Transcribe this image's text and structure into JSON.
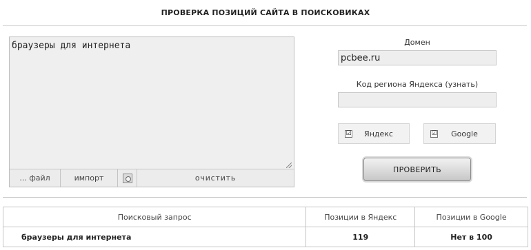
{
  "title": "ПРОВЕРКА ПОЗИЦИЙ САЙТА В ПОИСКОВИКАХ",
  "query_text": "браузеры для интернета",
  "toolbar": {
    "file_label": "... файл",
    "import_label": "импорт",
    "icon": "settings-file-icon",
    "clear_label": "очистить"
  },
  "domain": {
    "label": "Домен",
    "value": "pcbee.ru"
  },
  "region": {
    "label": "Код региона Яндекса (узнать)",
    "value": ""
  },
  "engines": {
    "yandex": {
      "label": "Яндекс",
      "checked": true,
      "mark": "☑"
    },
    "google": {
      "label": "Google",
      "checked": true,
      "mark": "☑"
    }
  },
  "check_button": "ПРОВЕРИТЬ",
  "results": {
    "headers": [
      "Поисковый запрос",
      "Позиции в Яндекс",
      "Позиции в Google"
    ],
    "rows": [
      [
        "браузеры для интернета",
        "119",
        "Нет в 100"
      ]
    ]
  },
  "colors": {
    "field_bg": "#eeeeee",
    "border": "#c4c4c4"
  }
}
